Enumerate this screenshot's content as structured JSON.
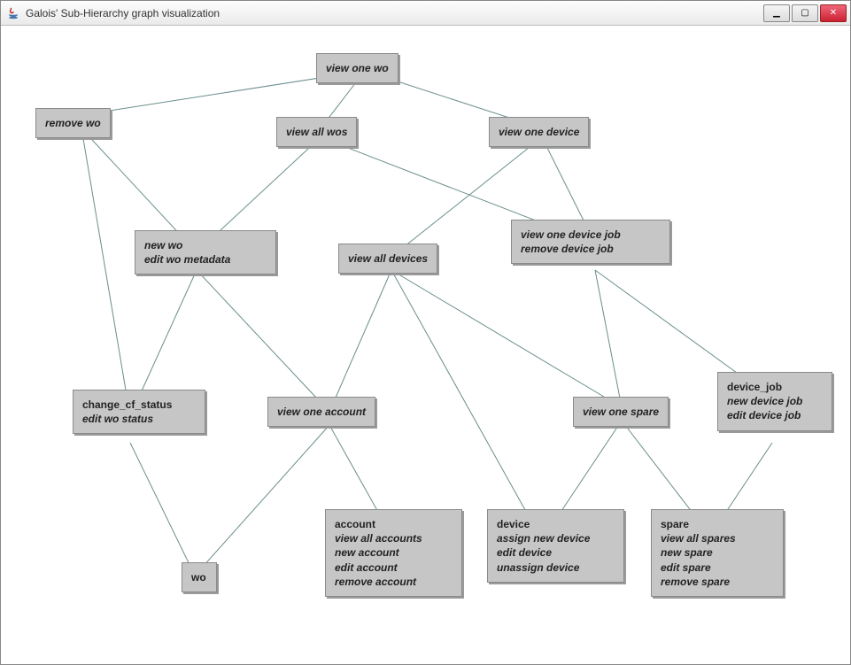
{
  "window": {
    "title": "Galois' Sub-Hierarchy graph visualization"
  },
  "nodes": {
    "view_one_wo": {
      "lines": [
        "view one wo"
      ]
    },
    "remove_wo": {
      "lines": [
        "remove wo"
      ]
    },
    "view_all_wos": {
      "lines": [
        "view all wos"
      ]
    },
    "view_one_device": {
      "lines": [
        "view one device"
      ]
    },
    "new_wo": {
      "lines": [
        "new wo",
        "edit wo metadata"
      ]
    },
    "view_all_devices": {
      "lines": [
        "view all devices"
      ]
    },
    "view_one_device_job": {
      "lines": [
        "view one device job",
        "remove device job"
      ]
    },
    "change_cf_status": {
      "title": "change_cf_status",
      "lines": [
        "edit wo status"
      ]
    },
    "view_one_account": {
      "lines": [
        "view one account"
      ]
    },
    "view_one_spare": {
      "lines": [
        "view one spare"
      ]
    },
    "device_job": {
      "title": "device_job",
      "lines": [
        "new device job",
        "edit device job"
      ]
    },
    "wo": {
      "title": "wo",
      "lines": []
    },
    "account": {
      "title": "account",
      "lines": [
        "view all accounts",
        "new account",
        "edit account",
        "remove account"
      ]
    },
    "device": {
      "title": "device",
      "lines": [
        "assign new device",
        "edit device",
        "unassign device"
      ]
    },
    "spare": {
      "title": "spare",
      "lines": [
        "view all spares",
        "new spare",
        "edit spare",
        "remove spare"
      ]
    }
  }
}
